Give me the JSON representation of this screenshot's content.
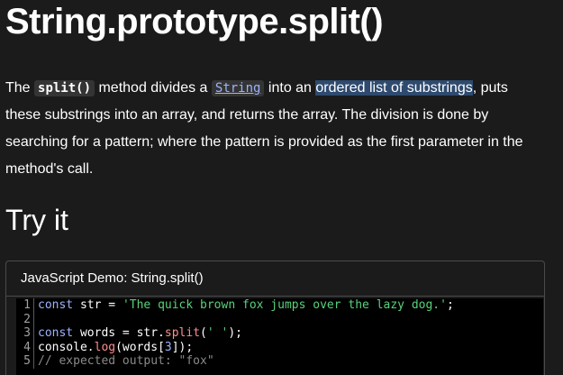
{
  "title": "String.prototype.split()",
  "intro": {
    "prefix": "The ",
    "method_code": "split()",
    "mid1": " method divides a ",
    "string_link": "String",
    "mid2": " into an ",
    "highlighted": "ordered list of substrings",
    "suffix": ", puts these substrings into an array, and returns the array. The division is done by searching for a pattern; where the pattern is provided as the first parameter in the method's call."
  },
  "try_it": {
    "heading": "Try it",
    "demo_title": "JavaScript Demo: String.split()"
  },
  "code": {
    "line_numbers": [
      "1",
      "2",
      "3",
      "4",
      "5"
    ],
    "l1_kw": "const",
    "l1_rest": " str = ",
    "l1_str": "'The quick brown fox jumps over the lazy dog.'",
    "l1_end": ";",
    "l3_kw": "const",
    "l3_rest": " words = str.",
    "l3_fn": "split",
    "l3_open": "(",
    "l3_str": "' '",
    "l3_end": ");",
    "l4_a": "console.",
    "l4_fn": "log",
    "l4_b": "(words[",
    "l4_num": "3",
    "l4_c": "]);",
    "l5_cmt": "// expected output: \"fox\""
  }
}
